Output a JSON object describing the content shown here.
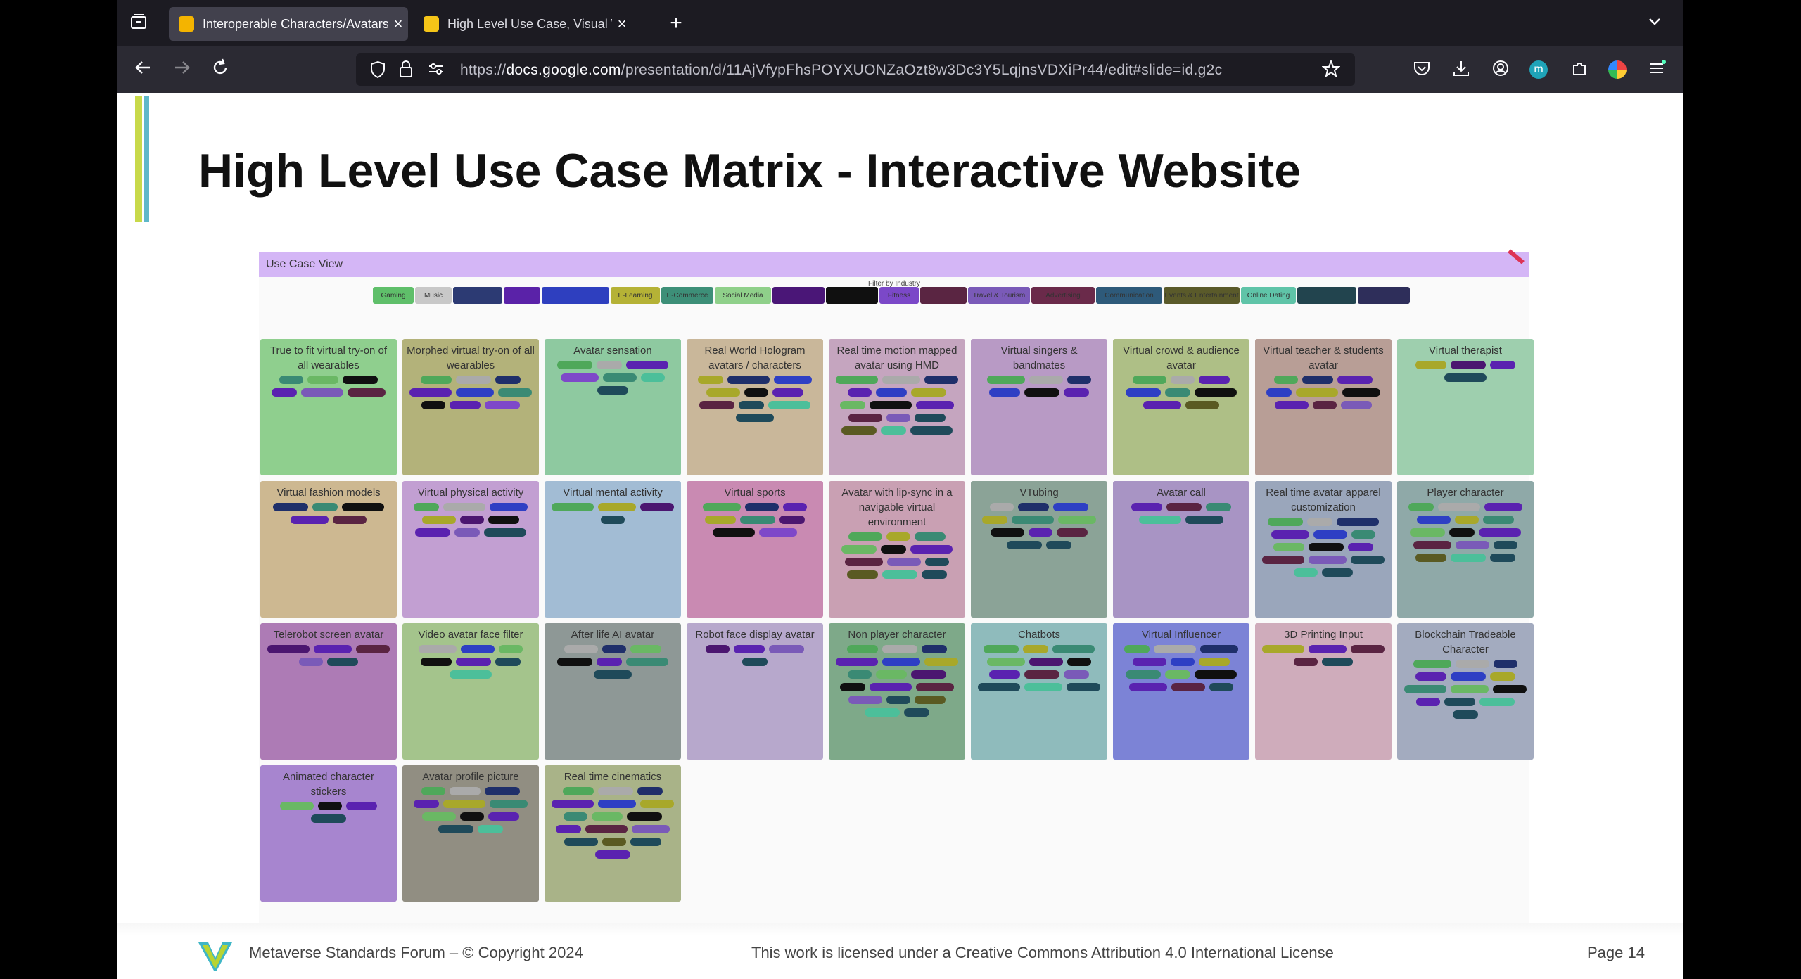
{
  "browser": {
    "tabs": [
      {
        "title": "Interoperable Characters/Avatars",
        "favicon_color": "#f4b400",
        "active": true
      },
      {
        "title": "High Level Use Case, Visual Wo",
        "favicon_color": "#f5c518",
        "active": false
      }
    ],
    "url": "https://docs.google.com/presentation/d/11AjVfypFhsPOYXUONZaOzt8w3Dc3Y5LqjnsVDXiPr44/edit#slide=id.g2c",
    "url_domain": "docs.google.com",
    "url_prefix": "https://",
    "url_suffix": "/presentation/d/11AjVfypFhsPOYXUONZaOzt8w3Dc3Y5LqjnsVDXiPr44/edit#slide=id.g2c",
    "icons": {
      "back": "back-arrow-icon",
      "forward": "forward-arrow-icon",
      "reload": "reload-icon",
      "new_tab": "plus-icon",
      "tab_list": "chevron-down-icon"
    },
    "profile_initial": "m"
  },
  "slide": {
    "title": "High Level Use Case Matrix - Interactive Website",
    "accent_colors": [
      "#c8d94a",
      "#5fb8c9"
    ],
    "footer": {
      "org": "Metaverse Standards Forum – © Copyright 2024",
      "license": "This work is licensed under a Creative Commons Attribution 4.0 International License",
      "page": "Page 14"
    }
  },
  "app": {
    "header_title": "Use Case View",
    "filter_label": "Filter by Industry",
    "filters": [
      {
        "label": "Gaming",
        "color": "#5fbf6a"
      },
      {
        "label": "Music",
        "color": "#c8c8c8"
      },
      {
        "label": "",
        "color": "#2c3a73"
      },
      {
        "label": "",
        "color": "#5a22a8"
      },
      {
        "label": "",
        "color": "#2e3fbf"
      },
      {
        "label": "E-Learning",
        "color": "#b5b236"
      },
      {
        "label": "E-Commerce",
        "color": "#3d8f78"
      },
      {
        "label": "Social Media",
        "color": "#8fd08a"
      },
      {
        "label": "",
        "color": "#4a1677"
      },
      {
        "label": "",
        "color": "#101010"
      },
      {
        "label": "Fitness",
        "color": "#7b48c8"
      },
      {
        "label": "",
        "color": "#5a2542"
      },
      {
        "label": "Travel & Tourism",
        "color": "#7a5ab8"
      },
      {
        "label": "Advertising",
        "color": "#6a2a4a"
      },
      {
        "label": "Communication",
        "color": "#2e5a7a"
      },
      {
        "label": "Events & Entertainment",
        "color": "#5a5a2a"
      },
      {
        "label": "Online Dating",
        "color": "#5fc4a8"
      },
      {
        "label": "",
        "color": "#22444e"
      },
      {
        "label": "",
        "color": "#2e2e5a"
      }
    ],
    "pill_colors": {
      "gaming": "#4fa85a",
      "music": "#aaaaaa",
      "navy": "#1f2f6a",
      "purple": "#5a22b0",
      "blue": "#2e3fc4",
      "elearning": "#a8a82a",
      "ecommerce": "#3a8a74",
      "social": "#6ab864",
      "violet": "#4b1670",
      "black": "#101010",
      "fitness": "#7e48c9",
      "plum": "#5a2442",
      "travel": "#7a5ab8",
      "teal": "#1f4a5a",
      "olive": "#5a5a22",
      "dating": "#4cbf9a"
    },
    "cards": [
      {
        "title": "True to fit virtual try-on of all wearables",
        "bg": "#8fcf8e",
        "pills": [
          "ecommerce",
          "social",
          "black",
          "purple",
          "travel",
          "plum"
        ]
      },
      {
        "title": "Morphed virtual try-on of all wearables",
        "bg": "#b3b27a",
        "pills": [
          "gaming",
          "music",
          "navy",
          "purple",
          "blue",
          "ecommerce",
          "black",
          "purple",
          "fitness"
        ]
      },
      {
        "title": "Avatar sensation",
        "bg": "#8ec9a0",
        "pills": [
          "gaming",
          "music",
          "purple",
          "fitness",
          "ecommerce",
          "dating",
          "teal"
        ]
      },
      {
        "title": "Real World Hologram avatars / characters",
        "bg": "#c9b79a",
        "pills": [
          "elearning",
          "navy",
          "blue",
          "elearning",
          "black",
          "purple",
          "plum",
          "teal",
          "dating",
          "teal"
        ]
      },
      {
        "title": "Real time motion mapped avatar using HMD",
        "bg": "#c5a5bf",
        "pills": [
          "gaming",
          "music",
          "navy",
          "purple",
          "blue",
          "elearning",
          "social",
          "black",
          "purple",
          "plum",
          "travel",
          "teal",
          "olive",
          "dating",
          "teal"
        ]
      },
      {
        "title": "Virtual singers & bandmates",
        "bg": "#b89ac5",
        "pills": [
          "gaming",
          "music",
          "navy",
          "blue",
          "black",
          "purple"
        ]
      },
      {
        "title": "Virtual crowd & audience avatar",
        "bg": "#aebf86",
        "pills": [
          "gaming",
          "music",
          "purple",
          "blue",
          "ecommerce",
          "black",
          "purple",
          "olive"
        ]
      },
      {
        "title": "Virtual teacher & students avatar",
        "bg": "#b89e96",
        "pills": [
          "gaming",
          "navy",
          "purple",
          "blue",
          "elearning",
          "black",
          "purple",
          "plum",
          "travel"
        ]
      },
      {
        "title": "Virtual therapist",
        "bg": "#9ecfae",
        "pills": [
          "elearning",
          "violet",
          "purple",
          "teal"
        ]
      },
      {
        "title": "Virtual fashion models",
        "bg": "#cdb891",
        "pills": [
          "navy",
          "ecommerce",
          "black",
          "purple",
          "plum"
        ]
      },
      {
        "title": "Virtual physical activity",
        "bg": "#c29fd2",
        "pills": [
          "gaming",
          "music",
          "blue",
          "elearning",
          "violet",
          "black",
          "purple",
          "travel",
          "teal"
        ]
      },
      {
        "title": "Virtual mental activity",
        "bg": "#a2bcd4",
        "pills": [
          "gaming",
          "elearning",
          "violet",
          "teal"
        ]
      },
      {
        "title": "Virtual sports",
        "bg": "#c98ab2",
        "pills": [
          "gaming",
          "navy",
          "purple",
          "elearning",
          "ecommerce",
          "violet",
          "black",
          "fitness"
        ]
      },
      {
        "title": "Avatar with lip-sync in a navigable virtual environment",
        "bg": "#c9a0b3",
        "pills": [
          "gaming",
          "elearning",
          "ecommerce",
          "social",
          "black",
          "purple",
          "plum",
          "travel",
          "teal",
          "olive",
          "dating",
          "teal"
        ]
      },
      {
        "title": "VTubing",
        "bg": "#8ba397",
        "pills": [
          "music",
          "navy",
          "blue",
          "elearning",
          "ecommerce",
          "social",
          "black",
          "purple",
          "plum",
          "teal",
          "teal"
        ]
      },
      {
        "title": "Avatar call",
        "bg": "#a894c4",
        "pills": [
          "purple",
          "plum",
          "ecommerce",
          "dating",
          "teal"
        ]
      },
      {
        "title": "Real time avatar apparel customization",
        "bg": "#9aa6bb",
        "pills": [
          "gaming",
          "music",
          "navy",
          "purple",
          "blue",
          "ecommerce",
          "social",
          "black",
          "purple",
          "plum",
          "travel",
          "teal",
          "dating",
          "teal"
        ]
      },
      {
        "title": "Player character",
        "bg": "#8fa9a8",
        "pills": [
          "gaming",
          "music",
          "purple",
          "blue",
          "elearning",
          "ecommerce",
          "social",
          "black",
          "purple",
          "plum",
          "travel",
          "teal",
          "olive",
          "dating",
          "teal"
        ]
      },
      {
        "title": "Telerobot screen avatar",
        "bg": "#ad7bb5",
        "pills": [
          "violet",
          "purple",
          "plum",
          "travel",
          "teal"
        ]
      },
      {
        "title": "Video avatar face filter",
        "bg": "#a4c48c",
        "pills": [
          "music",
          "blue",
          "social",
          "black",
          "purple",
          "teal",
          "dating"
        ]
      },
      {
        "title": "After life AI avatar",
        "bg": "#8e9896",
        "pills": [
          "music",
          "navy",
          "social",
          "black",
          "purple",
          "ecommerce",
          "teal"
        ]
      },
      {
        "title": "Robot face display avatar",
        "bg": "#b7a8cc",
        "pills": [
          "violet",
          "purple",
          "travel",
          "teal"
        ]
      },
      {
        "title": "Non player character",
        "bg": "#7ea989",
        "pills": [
          "gaming",
          "music",
          "navy",
          "purple",
          "blue",
          "elearning",
          "ecommerce",
          "social",
          "violet",
          "black",
          "purple",
          "plum",
          "travel",
          "teal",
          "olive",
          "dating",
          "teal"
        ]
      },
      {
        "title": "Chatbots",
        "bg": "#8fbbbc",
        "pills": [
          "gaming",
          "elearning",
          "ecommerce",
          "social",
          "violet",
          "black",
          "purple",
          "plum",
          "travel",
          "teal",
          "dating",
          "teal"
        ]
      },
      {
        "title": "Virtual Influencer",
        "bg": "#7c83d6",
        "pills": [
          "gaming",
          "music",
          "navy",
          "purple",
          "blue",
          "elearning",
          "ecommerce",
          "social",
          "black",
          "purple",
          "plum",
          "teal"
        ]
      },
      {
        "title": "3D Printing Input",
        "bg": "#cfacbb",
        "pills": [
          "elearning",
          "purple",
          "plum",
          "plum",
          "teal"
        ]
      },
      {
        "title": "Blockchain Tradeable Character",
        "bg": "#a3abbf",
        "pills": [
          "gaming",
          "music",
          "navy",
          "purple",
          "blue",
          "elearning",
          "ecommerce",
          "social",
          "black",
          "purple",
          "teal",
          "dating",
          "teal"
        ]
      },
      {
        "title": "Animated character stickers",
        "bg": "#a785cf",
        "pills": [
          "social",
          "black",
          "purple",
          "teal"
        ]
      },
      {
        "title": "Avatar profile picture",
        "bg": "#918e82",
        "pills": [
          "gaming",
          "music",
          "navy",
          "purple",
          "elearning",
          "ecommerce",
          "social",
          "black",
          "purple",
          "teal",
          "dating"
        ]
      },
      {
        "title": "Real time cinematics",
        "bg": "#a9b388",
        "pills": [
          "gaming",
          "music",
          "navy",
          "purple",
          "blue",
          "elearning",
          "ecommerce",
          "social",
          "black",
          "purple",
          "plum",
          "travel",
          "teal",
          "olive",
          "teal",
          "purple"
        ]
      }
    ]
  }
}
